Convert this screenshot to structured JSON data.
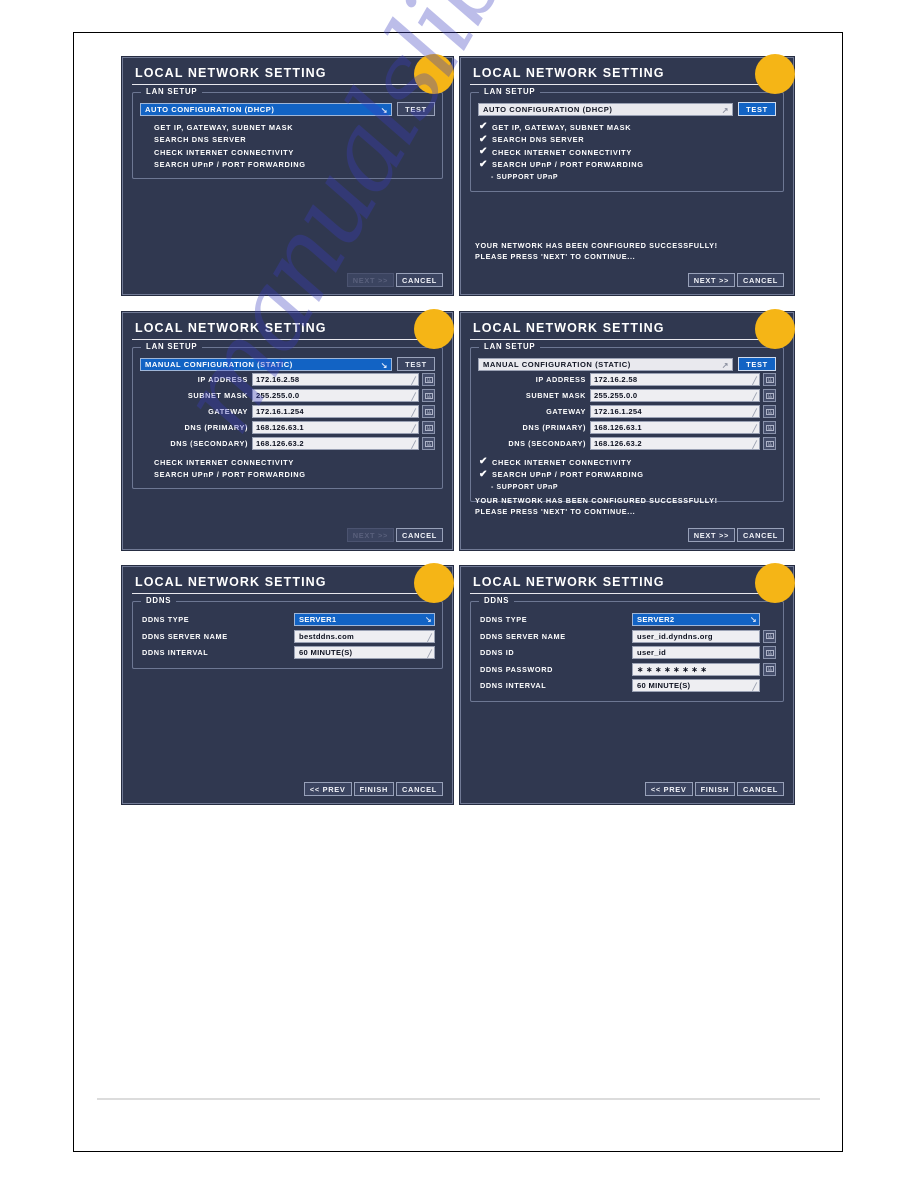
{
  "document": {
    "watermark_text": "manualslib.com"
  },
  "common": {
    "title": "LOCAL NETWORK SETTING",
    "lan_setup_legend": "LAN SETUP",
    "ddns_legend": "DDNS",
    "test_label": "TEST",
    "next_label": "NEXT >>",
    "cancel_label": "CANCEL",
    "prev_label": "<< PREV",
    "finish_label": "FINISH",
    "success_line1": "YOUR NETWORK HAS BEEN CONFIGURED SUCCESSFULLY!",
    "success_line2": "PLEASE PRESS 'NEXT' TO CONTINUE...",
    "checkmark": "✔",
    "dropdown_arrow": "↘",
    "dash": "-",
    "accent_blue": "#1263c4",
    "panel_bg": "#303850",
    "badge_color": "#f5b516"
  },
  "panel1": {
    "title": "LOCAL NETWORK SETTING",
    "legend": "LAN SETUP",
    "mode": "AUTO CONFIGURATION (DHCP)",
    "test": "TEST",
    "steps": [
      "GET IP, GATEWAY, SUBNET MASK",
      "SEARCH DNS SERVER",
      "CHECK INTERNET CONNECTIVITY",
      "SEARCH UPnP / PORT FORWARDING"
    ],
    "next": "NEXT >>",
    "cancel": "CANCEL"
  },
  "panel2": {
    "title": "LOCAL NETWORK SETTING",
    "legend": "LAN SETUP",
    "mode": "AUTO CONFIGURATION (DHCP)",
    "test": "TEST",
    "steps": [
      "GET IP, GATEWAY, SUBNET MASK",
      "SEARCH DNS SERVER",
      "CHECK INTERNET CONNECTIVITY",
      "SEARCH UPnP / PORT FORWARDING"
    ],
    "sub_step": "- SUPPORT UPnP",
    "status_line1": "YOUR NETWORK HAS BEEN CONFIGURED SUCCESSFULLY!",
    "status_line2": "PLEASE PRESS 'NEXT' TO CONTINUE...",
    "next": "NEXT >>",
    "cancel": "CANCEL"
  },
  "panel3": {
    "title": "LOCAL NETWORK SETTING",
    "legend": "LAN SETUP",
    "mode": "MANUAL CONFIGURATION (STATIC)",
    "test": "TEST",
    "fields": [
      {
        "label": "IP ADDRESS",
        "value": "172.16.2.58"
      },
      {
        "label": "SUBNET MASK",
        "value": "255.255.0.0"
      },
      {
        "label": "GATEWAY",
        "value": "172.16.1.254"
      },
      {
        "label": "DNS (PRIMARY)",
        "value": "168.126.63.1"
      },
      {
        "label": "DNS (SECONDARY)",
        "value": "168.126.63.2"
      }
    ],
    "steps": [
      "CHECK INTERNET CONNECTIVITY",
      "SEARCH UPnP / PORT FORWARDING"
    ],
    "next": "NEXT >>",
    "cancel": "CANCEL"
  },
  "panel4": {
    "title": "LOCAL NETWORK SETTING",
    "legend": "LAN SETUP",
    "mode": "MANUAL CONFIGURATION (STATIC)",
    "test": "TEST",
    "fields": [
      {
        "label": "IP ADDRESS",
        "value": "172.16.2.58"
      },
      {
        "label": "SUBNET MASK",
        "value": "255.255.0.0"
      },
      {
        "label": "GATEWAY",
        "value": "172.16.1.254"
      },
      {
        "label": "DNS (PRIMARY)",
        "value": "168.126.63.1"
      },
      {
        "label": "DNS (SECONDARY)",
        "value": "168.126.63.2"
      }
    ],
    "steps": [
      "CHECK INTERNET CONNECTIVITY",
      "SEARCH UPnP / PORT FORWARDING"
    ],
    "sub_step": "- SUPPORT UPnP",
    "status_line1": "YOUR NETWORK HAS BEEN CONFIGURED SUCCESSFULLY!",
    "status_line2": "PLEASE PRESS 'NEXT' TO CONTINUE...",
    "next": "NEXT >>",
    "cancel": "CANCEL"
  },
  "panel5": {
    "title": "LOCAL NETWORK SETTING",
    "legend": "DDNS",
    "rows": [
      {
        "label": "DDNS TYPE",
        "value": "SERVER1",
        "selected": true
      },
      {
        "label": "DDNS SERVER NAME",
        "value": "bestddns.com",
        "selected": false
      },
      {
        "label": "DDNS INTERVAL",
        "value": "60  MINUTE(S)",
        "selected": false
      }
    ],
    "prev": "<< PREV",
    "finish": "FINISH",
    "cancel": "CANCEL"
  },
  "panel6": {
    "title": "LOCAL NETWORK SETTING",
    "legend": "DDNS",
    "rows": [
      {
        "label": "DDNS TYPE",
        "value": "SERVER2",
        "selected": true,
        "kb": false
      },
      {
        "label": "DDNS SERVER NAME",
        "value": "user_id.dyndns.org",
        "selected": false,
        "kb": true
      },
      {
        "label": "DDNS ID",
        "value": "user_id",
        "selected": false,
        "kb": true
      },
      {
        "label": "DDNS PASSWORD",
        "value": "∗ ∗ ∗ ∗ ∗ ∗ ∗ ∗",
        "selected": false,
        "kb": true
      },
      {
        "label": "DDNS INTERVAL",
        "value": "60  MINUTE(S)",
        "selected": false,
        "kb": false
      }
    ],
    "prev": "<< PREV",
    "finish": "FINISH",
    "cancel": "CANCEL"
  }
}
